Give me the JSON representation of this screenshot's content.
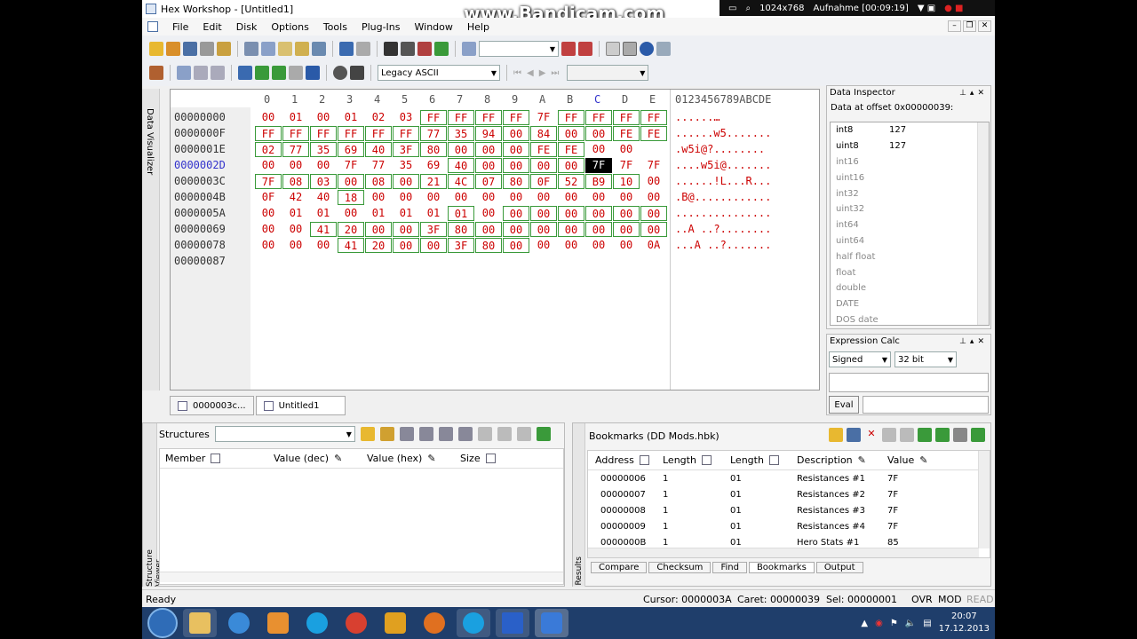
{
  "window_title": "Hex Workshop - [Untitled1]",
  "recorder": {
    "resolution": "1024x768",
    "status": "Aufnahme [00:09:19]"
  },
  "watermark": "www.Bandicam.com",
  "menu": [
    "File",
    "Edit",
    "Disk",
    "Options",
    "Tools",
    "Plug-Ins",
    "Window",
    "Help"
  ],
  "toolbar": {
    "encoding": "Legacy ASCII"
  },
  "side_tab": "Data Visualizer",
  "hex": {
    "header_cols": [
      "0",
      "1",
      "2",
      "3",
      "4",
      "5",
      "6",
      "7",
      "8",
      "9",
      "A",
      "B",
      "C",
      "D",
      "E"
    ],
    "ascii_header": "0123456789ABCDE",
    "rows": [
      {
        "addr": "00000000",
        "bytes": [
          "00",
          "01",
          "00",
          "01",
          "02",
          "03",
          "FF",
          "FF",
          "FF",
          "FF",
          "7F",
          "FF",
          "FF",
          "FF",
          "FF"
        ],
        "ascii": "......…"
      },
      {
        "addr": "0000000F",
        "bytes": [
          "FF",
          "FF",
          "FF",
          "FF",
          "FF",
          "FF",
          "77",
          "35",
          "94",
          "00",
          "84",
          "00",
          "00",
          "FE",
          "FE"
        ],
        "ascii": "......w5......."
      },
      {
        "addr": "0000001E",
        "bytes": [
          "02",
          "77",
          "35",
          "69",
          "40",
          "3F",
          "80",
          "00",
          "00",
          "00",
          "FE",
          "FE",
          "00",
          "00",
          ""
        ],
        "ascii": ".w5i@?........"
      },
      {
        "addr": "0000002D",
        "bytes": [
          "00",
          "00",
          "00",
          "7F",
          "77",
          "35",
          "69",
          "40",
          "00",
          "00",
          "00",
          "00",
          "7F",
          "7F",
          "7F"
        ],
        "ascii": "....w5i@......."
      },
      {
        "addr": "0000003C",
        "bytes": [
          "7F",
          "08",
          "03",
          "00",
          "08",
          "00",
          "21",
          "4C",
          "07",
          "80",
          "0F",
          "52",
          "B9",
          "10",
          "00"
        ],
        "ascii": "......!L...R..."
      },
      {
        "addr": "0000004B",
        "bytes": [
          "0F",
          "42",
          "40",
          "18",
          "00",
          "00",
          "00",
          "00",
          "00",
          "00",
          "00",
          "00",
          "00",
          "00",
          "00"
        ],
        "ascii": ".B@............"
      },
      {
        "addr": "0000005A",
        "bytes": [
          "00",
          "01",
          "01",
          "00",
          "01",
          "01",
          "01",
          "01",
          "00",
          "00",
          "00",
          "00",
          "00",
          "00",
          "00"
        ],
        "ascii": "..............."
      },
      {
        "addr": "00000069",
        "bytes": [
          "00",
          "00",
          "41",
          "20",
          "00",
          "00",
          "3F",
          "80",
          "00",
          "00",
          "00",
          "00",
          "00",
          "00",
          "00"
        ],
        "ascii": "..A ..?........"
      },
      {
        "addr": "00000078",
        "bytes": [
          "00",
          "00",
          "00",
          "41",
          "20",
          "00",
          "00",
          "3F",
          "80",
          "00",
          "00",
          "00",
          "00",
          "00",
          "0A"
        ],
        "ascii": "...A ..?......."
      },
      {
        "addr": "00000087",
        "bytes": [],
        "ascii": ""
      }
    ]
  },
  "doc_tabs": [
    "0000003c...",
    "Untitled1"
  ],
  "data_inspector": {
    "title": "Data Inspector",
    "offset_label": "Data at offset 0x00000039:",
    "rows": [
      {
        "name": "int8",
        "value": "127"
      },
      {
        "name": "uint8",
        "value": "127"
      },
      {
        "name": "int16",
        "value": ""
      },
      {
        "name": "uint16",
        "value": ""
      },
      {
        "name": "int32",
        "value": ""
      },
      {
        "name": "uint32",
        "value": ""
      },
      {
        "name": "int64",
        "value": ""
      },
      {
        "name": "uint64",
        "value": ""
      },
      {
        "name": "half float",
        "value": ""
      },
      {
        "name": "float",
        "value": ""
      },
      {
        "name": "double",
        "value": ""
      },
      {
        "name": "DATE",
        "value": ""
      },
      {
        "name": "DOS date",
        "value": ""
      }
    ]
  },
  "expression_calc": {
    "title": "Expression Calc",
    "sign": "Signed",
    "bits": "32 bit",
    "eval": "Eval"
  },
  "structures": {
    "label": "Structures",
    "columns": [
      "Member",
      "Value (dec)",
      "Value (hex)",
      "Size"
    ],
    "side": "Structure Viewer"
  },
  "bookmarks": {
    "title": "Bookmarks (DD Mods.hbk)",
    "columns": [
      "Address",
      "Length",
      "Length",
      "Description",
      "Value"
    ],
    "rows": [
      {
        "addr": "00000006",
        "len": "1",
        "len2": "01",
        "desc": "Resistances #1",
        "val": "7F"
      },
      {
        "addr": "00000007",
        "len": "1",
        "len2": "01",
        "desc": "Resistances #2",
        "val": "7F"
      },
      {
        "addr": "00000008",
        "len": "1",
        "len2": "01",
        "desc": "Resistances #3",
        "val": "7F"
      },
      {
        "addr": "00000009",
        "len": "1",
        "len2": "01",
        "desc": "Resistances #4",
        "val": "7F"
      },
      {
        "addr": "0000000B",
        "len": "1",
        "len2": "01",
        "desc": "Hero Stats #1",
        "val": "85"
      }
    ],
    "tabs": [
      "Compare",
      "Checksum",
      "Find",
      "Bookmarks",
      "Output"
    ],
    "side": "Results"
  },
  "status": {
    "ready": "Ready",
    "cursor": "Cursor: 0000003A",
    "caret": "Caret: 00000039",
    "sel": "Sel: 00000001",
    "ovr": "OVR",
    "mod": "MOD",
    "read": "READ"
  },
  "clock": {
    "time": "20:07",
    "date": "17.12.2013"
  }
}
